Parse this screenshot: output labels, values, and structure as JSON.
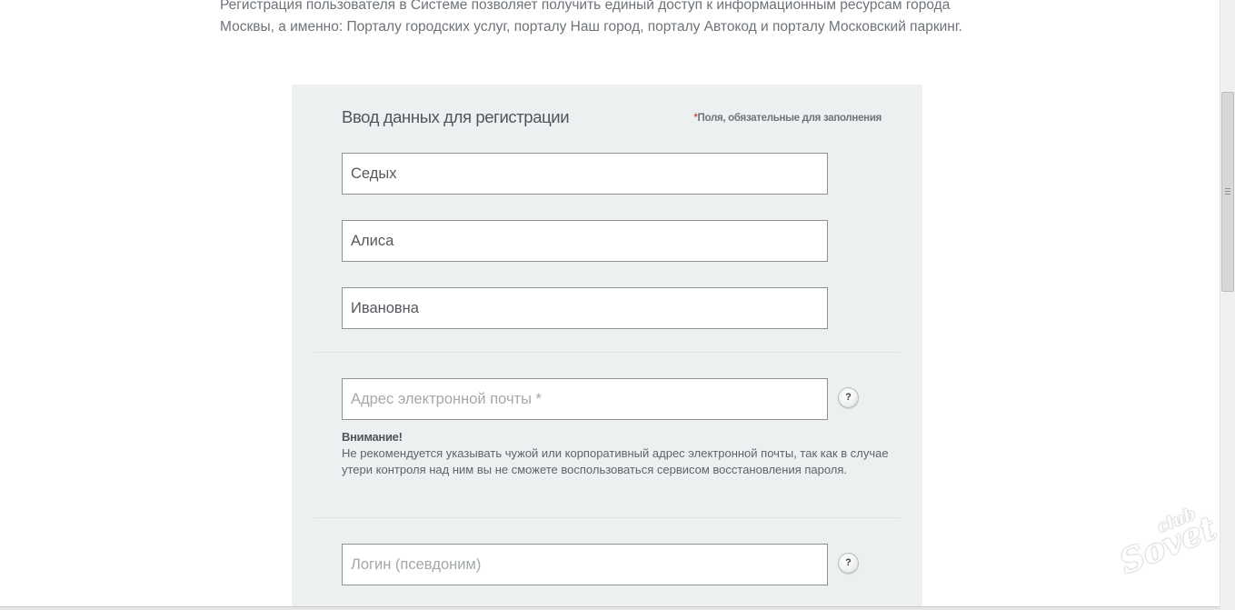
{
  "intro": {
    "text": "Регистрация пользователя в Системе позволяет получить единый доступ к информационным ресурсам города Москвы, а именно: Порталу городских услуг, порталу Наш город, порталу Автокод и порталу Московский паркинг."
  },
  "form": {
    "title": "Ввод данных для регистрации",
    "required_star": "*",
    "required_note": "Поля, обязательные для заполнения",
    "fields": {
      "last_name": {
        "value": "Седых"
      },
      "first_name": {
        "value": "Алиса"
      },
      "middle_name": {
        "value": "Ивановна"
      },
      "email": {
        "value": "",
        "placeholder": "Адрес электронной почты *"
      },
      "login": {
        "value": "",
        "placeholder": "Логин (псевдоним)"
      }
    },
    "help_label": "?",
    "warning": {
      "title": "Внимание!",
      "text": "Не рекомендуется указывать чужой или корпоративный адрес электронной почты, так как в случае утери контроля над ним вы не сможете воспользоваться сервисом восстановления пароля."
    }
  },
  "watermark": {
    "small": "club",
    "big": "Sovet"
  },
  "icons": {
    "help": "help-icon",
    "scroll_grip": "grip-icon"
  },
  "colors": {
    "panel_bg": "#edf0f0",
    "required_star": "#d51b1b",
    "field_border": "#8c9194",
    "text_muted": "#6d7378"
  }
}
